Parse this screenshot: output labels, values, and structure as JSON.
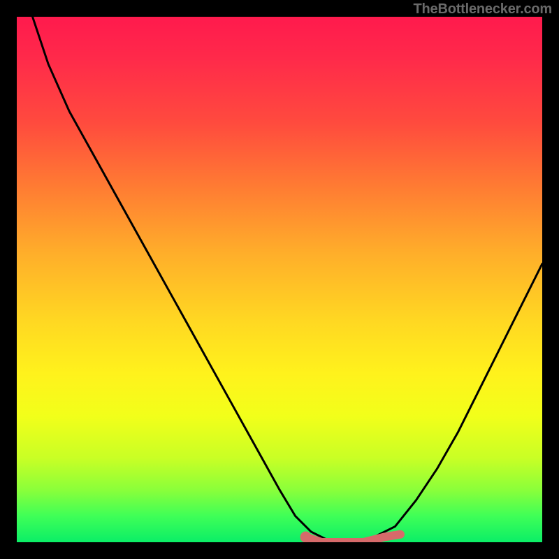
{
  "watermark": {
    "text": "TheBottlenecker.com"
  },
  "chart_data": {
    "type": "line",
    "title": "",
    "xlabel": "",
    "ylabel": "",
    "xlim": [
      0,
      100
    ],
    "ylim": [
      0,
      100
    ],
    "grid": false,
    "legend": false,
    "series": [
      {
        "name": "curve",
        "color": "#000000",
        "x": [
          3,
          6,
          10,
          15,
          20,
          25,
          30,
          35,
          40,
          45,
          50,
          53,
          56,
          58,
          60,
          64,
          68,
          72,
          76,
          80,
          84,
          88,
          92,
          96,
          100
        ],
        "values": [
          100,
          91,
          82,
          73,
          64,
          55,
          46,
          37,
          28,
          19,
          10,
          5,
          2,
          1,
          0,
          0,
          1,
          3,
          8,
          14,
          21,
          29,
          37,
          45,
          53
        ]
      },
      {
        "name": "highlight",
        "color": "#d66a6a",
        "x": [
          55,
          58,
          62,
          66,
          70,
          73
        ],
        "values": [
          1,
          0,
          0,
          0,
          1,
          1.5
        ]
      },
      {
        "name": "highlight_dot",
        "color": "#d66a6a",
        "x": [
          55
        ],
        "values": [
          1
        ]
      }
    ],
    "background_gradient": {
      "stops": [
        {
          "offset": 0.0,
          "color": "#ff1a4d"
        },
        {
          "offset": 0.2,
          "color": "#ff4a3e"
        },
        {
          "offset": 0.45,
          "color": "#ffae2a"
        },
        {
          "offset": 0.68,
          "color": "#fff21c"
        },
        {
          "offset": 0.9,
          "color": "#8bff3a"
        },
        {
          "offset": 1.0,
          "color": "#0bee67"
        }
      ]
    }
  }
}
